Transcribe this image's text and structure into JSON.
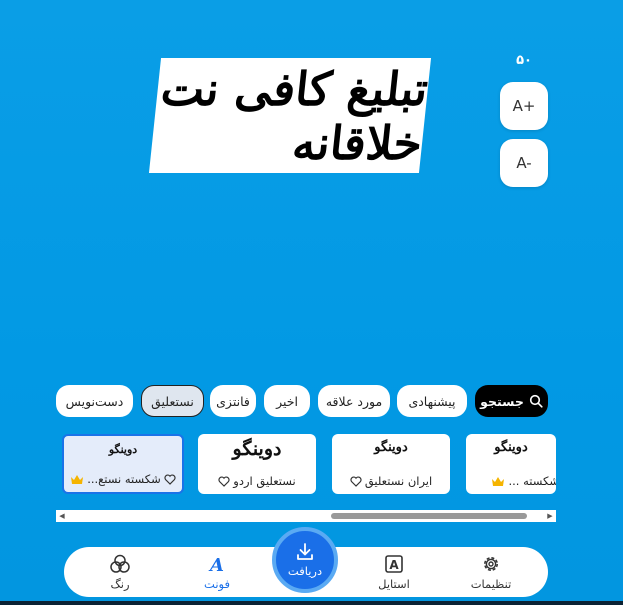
{
  "preview": {
    "text": "تبلیغ کافی نت خلاقانه"
  },
  "font_size": {
    "value": "۵۰",
    "increase_label": "A+",
    "decrease_label": "A-"
  },
  "categories": {
    "search_label": "جستجو",
    "chips": [
      {
        "label": "پیشنهادی"
      },
      {
        "label": "مورد علاقه"
      },
      {
        "label": "اخیر"
      },
      {
        "label": "فانتزی"
      },
      {
        "label": "نستعلیق"
      },
      {
        "label": "دست‌نویس"
      }
    ],
    "selected": "نستعلیق"
  },
  "fonts": [
    {
      "sample": "دوینگو",
      "label": "یما شکسته ...",
      "premium": true
    },
    {
      "sample": "دوینگو",
      "label": "ایران نستعلیق",
      "premium": false
    },
    {
      "sample": "دوینگو",
      "label": "نستعلیق اردو",
      "premium": false
    },
    {
      "sample": "دوینگو",
      "label": "شکسته نستع...",
      "premium": true,
      "selected": true
    }
  ],
  "nav": {
    "settings": "تنظیمات",
    "style": "استایل",
    "download": "دریافت",
    "font": "فونت",
    "color": "رنگ"
  },
  "colors": {
    "accent": "#1a6fe8",
    "premium": "#f5b400",
    "background": "#0299e4"
  }
}
